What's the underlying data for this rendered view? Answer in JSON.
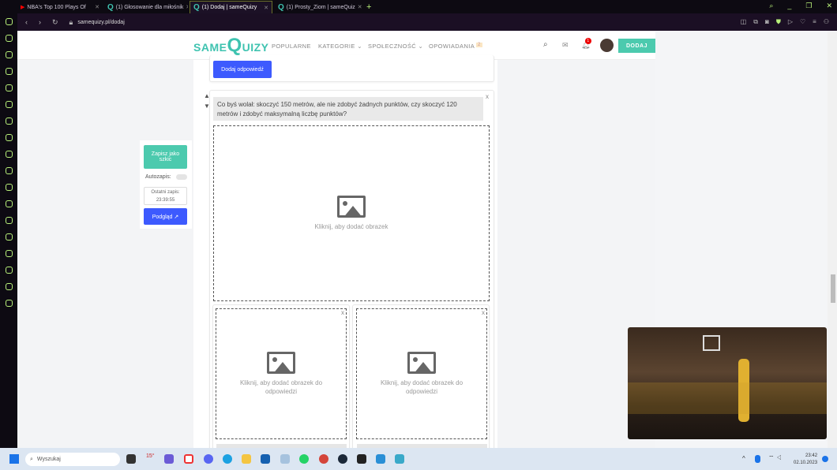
{
  "browser": {
    "tabs": [
      {
        "label": "NBA's Top 100 Plays Of",
        "active": false
      },
      {
        "label": "(1) Głosowanie dla miłośnik",
        "active": false
      },
      {
        "label": "(1) Dodaj | sameQuizy",
        "active": true
      },
      {
        "label": "(1) Prosty_Ziom | sameQuiz",
        "active": false
      }
    ],
    "url": "samequizy.pl/dodaj",
    "new_tab": "+"
  },
  "site": {
    "logo_small": "SAME",
    "logo_big": "Q",
    "logo_rest": "UIZY",
    "nav": [
      "POPULARNE",
      "KATEGORIE ⌄",
      "SPOŁECZNOŚĆ ⌄",
      "OPOWIADANIA"
    ],
    "opowiadania_badge": "2",
    "notif_count": "1",
    "add_button": "DODAJ"
  },
  "editor": {
    "add_answer": "Dodaj odpowiedź",
    "question": "Co byś wolał: skoczyć 150 metrów, ale nie zdobyć żadnych punktów, czy skoczyć 120 metrów i zdobyć maksymalną liczbę punktów?",
    "add_image": "Kliknij, aby dodać obrazek",
    "add_answer_image": "Kliknij, aby dodać obrazek do odpowiedzi",
    "close": "x"
  },
  "save_panel": {
    "save_draft": "Zapisz jako szkic",
    "autosave_label": "Autozapis:",
    "autosave_on": false,
    "last_save_label": "Ostatni zapis:",
    "last_save_time": "23:39:55",
    "preview": "Podgląd ↗"
  },
  "taskbar": {
    "search": "Wyszukaj",
    "temp": "15°",
    "time": "23:42",
    "date": "02.10.2023"
  }
}
